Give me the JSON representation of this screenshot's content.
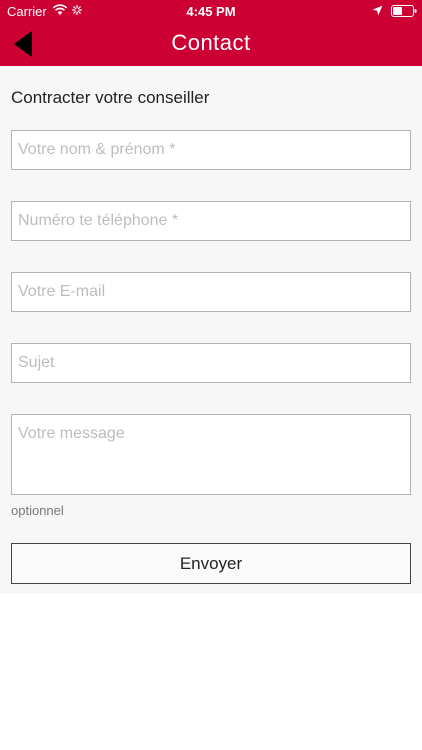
{
  "status_bar": {
    "carrier": "Carrier",
    "time": "4:45 PM"
  },
  "nav": {
    "title": "Contact"
  },
  "form": {
    "heading": "Contracter votre conseiller",
    "name_placeholder": "Votre nom & prénom *",
    "phone_placeholder": "Numéro te téléphone *",
    "email_placeholder": "Votre E-mail",
    "subject_placeholder": "Sujet",
    "message_placeholder": "Votre message",
    "optional_hint": "optionnel",
    "submit_label": "Envoyer"
  },
  "colors": {
    "brand": "#cc0033",
    "background": "#f7f7f7"
  }
}
